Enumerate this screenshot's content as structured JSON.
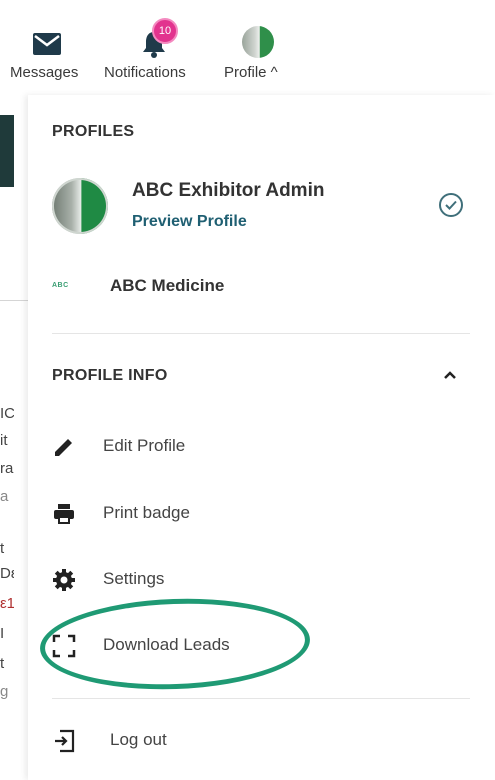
{
  "topnav": {
    "messages_label": "Messages",
    "notifications_label": "Notifications",
    "notifications_count": "10",
    "profile_label": "Profile ^"
  },
  "profiles": {
    "section_title": "PROFILES",
    "active": {
      "name": "ABC Exhibitor Admin",
      "link": "Preview Profile"
    },
    "other": {
      "logo_text": "ABC",
      "name": "ABC Medicine"
    }
  },
  "profile_info": {
    "section_title": "PROFILE INFO",
    "items": [
      {
        "label": "Edit Profile",
        "icon": "pencil-icon"
      },
      {
        "label": "Print badge",
        "icon": "printer-icon"
      },
      {
        "label": "Settings",
        "icon": "gear-icon"
      },
      {
        "label": "Download Leads",
        "icon": "scan-frame-icon"
      }
    ]
  },
  "logout_label": "Log out",
  "background_fragments": [
    "IC",
    "it",
    "ra",
    "a",
    "t",
    "Dε",
    "ε1",
    "I",
    "t",
    "g"
  ],
  "colors": {
    "accent_link": "#1f5f72",
    "badge": "#e2338e",
    "highlight": "#1f9a74"
  }
}
